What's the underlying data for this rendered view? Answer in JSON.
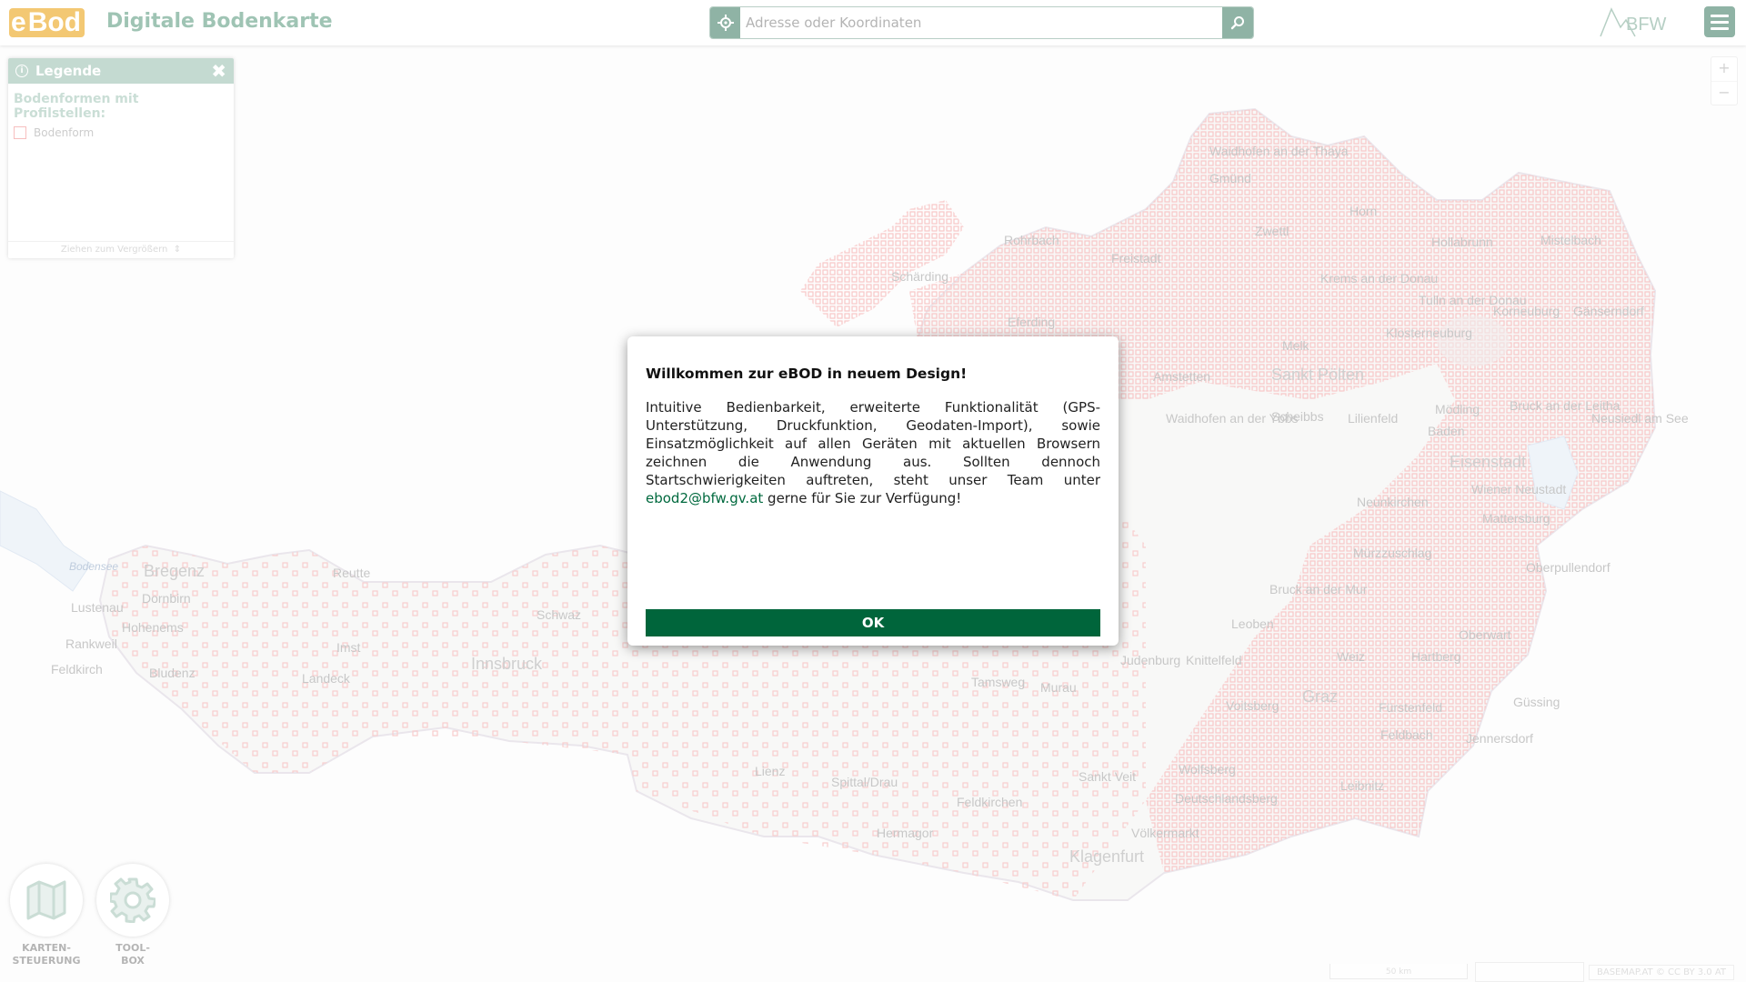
{
  "app": {
    "logo_e": "e",
    "logo_bod": "Bod",
    "title": "Digitale Bodenkarte",
    "partner_logo_text": "BFW"
  },
  "search": {
    "placeholder": "Adresse oder Koordinaten",
    "value": ""
  },
  "zoom": {
    "in_label": "+",
    "out_label": "−"
  },
  "legend": {
    "title": "Legende",
    "section_title": "Bodenformen mit Profilstellen:",
    "items": [
      {
        "label": "Bodenform",
        "color": "#f08a8a"
      }
    ],
    "resize_hint": "Ziehen zum Vergrößern"
  },
  "modal": {
    "title": "Willkommen zur eBOD in neuem Design!",
    "text_before_link": "Intuitive Bedienbarkeit, erweiterte Funktionalität (GPS-Unterstützung, Druckfunktion, Geodaten-Import), sowie Einsatzmöglichkeit auf allen Geräten mit aktuellen Browsern zeichnen die Anwendung aus. Sollten dennoch Startschwierigkeiten auftreten, steht unser Team unter",
    "link_email": "ebod2@bfw.gv.at",
    "text_after_link": "gerne für Sie zur Verfügung!",
    "ok_label": "OK"
  },
  "tools": [
    {
      "line1": "KARTEN-",
      "line2": "STEUERUNG",
      "icon": "map-icon"
    },
    {
      "line1": "TOOL-",
      "line2": "BOX",
      "icon": "gear-icon"
    }
  ],
  "footer": {
    "scale_label": "50 km",
    "attribution": "BASEMAP.AT © CC BY 3.0 AT"
  },
  "map_labels": [
    "Waidhofen an der Thaya",
    "Gmünd",
    "Zwettl",
    "Horn",
    "Hollabrunn",
    "Mistelbach",
    "Rohrbach",
    "Freistadt",
    "Schärding",
    "Krems an der Donau",
    "Tulln an der Donau",
    "Korneuburg",
    "Gänserndorf",
    "Eferding",
    "Klosterneuburg",
    "Melk",
    "Sankt Pölten",
    "Amstetten",
    "Waidhofen an der Ybbs",
    "Scheibbs",
    "Lilienfeld",
    "Mödling",
    "Baden",
    "Bruck an der Leitha",
    "Neusiedl am See",
    "Eisenstadt",
    "Wiener Neustadt",
    "Mattersburg",
    "Neunkirchen",
    "Mürzzuschlag",
    "Oberpullendorf",
    "Bregenz",
    "Dornbirn",
    "Lustenau",
    "Hohenems",
    "Rankweil",
    "Feldkirch",
    "Bludenz",
    "Reutte",
    "Schwaz",
    "Imst",
    "Landeck",
    "Innsbruck",
    "Bruck an der Mur",
    "Leoben",
    "Oberwart",
    "Hartberg",
    "Weiz",
    "Graz",
    "Güssing",
    "Fürstenfeld",
    "Feldbach",
    "Jennersdorf",
    "Judenburg",
    "Knittelfeld",
    "Voitsberg",
    "Leibnitz",
    "Deutschlandsberg",
    "Wolfsberg",
    "Sankt Veit",
    "Völkermarkt",
    "Klagenfurt",
    "Feldkirchen",
    "Spittal/Drau",
    "Hermagor",
    "Lienz",
    "Tamsweg",
    "Murau",
    "Bodensee"
  ]
}
